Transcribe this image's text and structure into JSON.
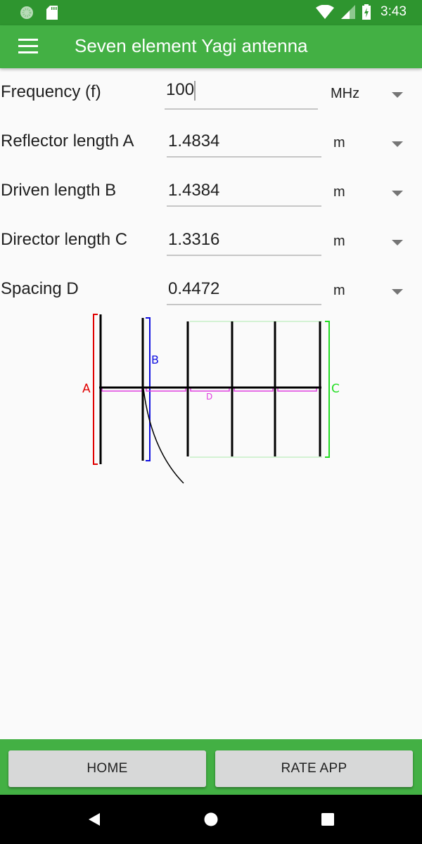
{
  "status_bar": {
    "time": "3:43",
    "icons": [
      "sync-icon",
      "sd-card-icon",
      "wifi-icon",
      "cell-signal-icon",
      "battery-charging-icon"
    ]
  },
  "app_bar": {
    "title": "Seven element Yagi antenna",
    "menu_icon": "hamburger-menu-icon"
  },
  "form": {
    "fields": [
      {
        "label": "Frequency (f)",
        "value": "100",
        "unit": "MHz",
        "focused": true
      },
      {
        "label": "Reflector length A",
        "value": "1.4834",
        "unit": "m"
      },
      {
        "label": "Driven length B",
        "value": "1.4384",
        "unit": "m"
      },
      {
        "label": "Director length C",
        "value": "1.3316",
        "unit": "m"
      },
      {
        "label": "Spacing D",
        "value": "0.4472",
        "unit": "m"
      }
    ]
  },
  "diagram": {
    "labels": {
      "a": "A",
      "b": "B",
      "c": "C",
      "d": "D"
    },
    "colors": {
      "a": "#e00000",
      "b": "#1010e0",
      "c": "#22dd22",
      "d": "#e040e0",
      "element": "#000000"
    },
    "element_count": 7
  },
  "bottom_bar": {
    "home_label": "HOME",
    "rate_label": "RATE APP"
  },
  "nav_bar": {
    "back_icon": "back-triangle-icon",
    "home_icon": "home-circle-icon",
    "recents_icon": "recents-square-icon"
  },
  "colors": {
    "status_bar": "#2e952f",
    "primary": "#43b044",
    "button": "#d7d8d8"
  }
}
